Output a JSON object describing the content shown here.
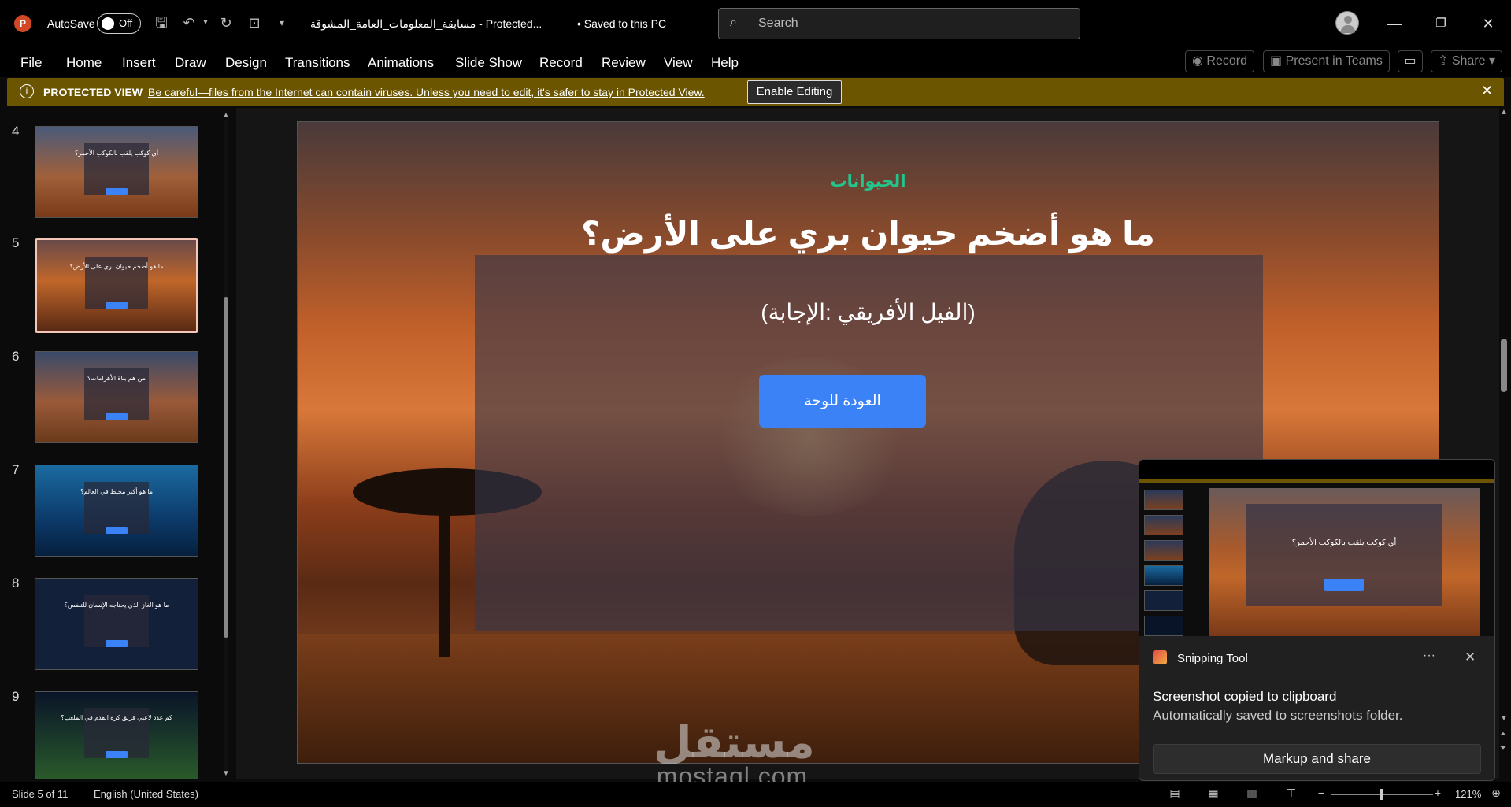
{
  "titlebar": {
    "app_logo": "P",
    "autosave_label": "AutoSave",
    "autosave_state": "Off",
    "doc_title": "مسابقة_المعلومات_العامة_المشوقة  -  Protected...",
    "saved_status": "• Saved to this PC",
    "search_placeholder": "Search",
    "icons": [
      "save-icon",
      "undo-icon",
      "redo-icon",
      "present-icon",
      "customize-icon"
    ]
  },
  "ribbon": {
    "tabs": [
      "File",
      "Home",
      "Insert",
      "Draw",
      "Design",
      "Transitions",
      "Animations",
      "Slide Show",
      "Record",
      "Review",
      "View",
      "Help"
    ],
    "record_label": "Record",
    "present_teams_label": "Present in Teams",
    "share_label": "Share"
  },
  "protected_view": {
    "title": "PROTECTED VIEW",
    "message": "Be careful—files from the Internet can contain viruses. Unless you need to edit, it's safer to stay in Protected View.",
    "enable_label": "Enable Editing"
  },
  "slide_panel": {
    "slides": [
      {
        "number": "4",
        "title": "أي كوكب يلقب بالكوكب الأحمر؟",
        "theme": "mars",
        "selected": false
      },
      {
        "number": "5",
        "title": "ما هو أضخم حيوان بري على الأرض؟",
        "theme": "savanna",
        "selected": true
      },
      {
        "number": "6",
        "title": "من هم بناة الأهرامات؟",
        "theme": "pyramids",
        "selected": false
      },
      {
        "number": "7",
        "title": "ما هو أكبر محيط في العالم؟",
        "theme": "ocean",
        "selected": false
      },
      {
        "number": "8",
        "title": "ما هو الغاز الذي يحتاجه الإنسان للتنفس؟",
        "theme": "dark",
        "selected": false
      },
      {
        "number": "9",
        "title": "كم عدد لاعبي فريق كرة القدم في الملعب؟",
        "theme": "stadium",
        "selected": false
      }
    ]
  },
  "slide": {
    "category": "الحيوانات",
    "question": "ما هو أضخم حيوان بري على الأرض؟",
    "answer": "(الفيل الأفريقي :الإجابة)",
    "button_label": "العودة للوحة",
    "category_color": "#22c58b",
    "button_color": "#3b82f6"
  },
  "watermark": {
    "arabic": "مستقل",
    "latin": "mostaql.com"
  },
  "snipping_toast": {
    "app_name": "Snipping Tool",
    "more_label": "···",
    "heading": "Screenshot copied to clipboard",
    "body": "Automatically saved to screenshots folder.",
    "button_label": "Markup and share",
    "preview_question": "أي كوكب يلقب بالكوكب الأحمر؟"
  },
  "statusbar": {
    "slide_info": "Slide 5 of 11",
    "language": "English (United States)",
    "zoom": "121%"
  }
}
